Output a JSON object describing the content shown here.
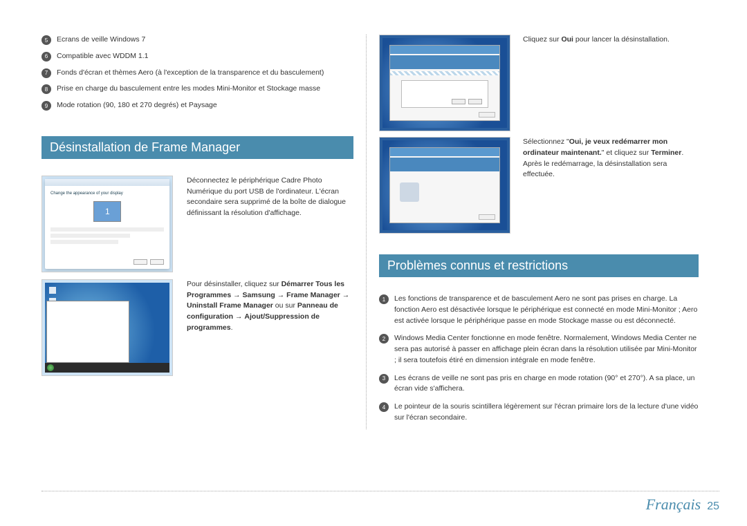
{
  "numbered_top": [
    {
      "n": "5",
      "text": "Ecrans de veille Windows 7"
    },
    {
      "n": "6",
      "text": "Compatible avec WDDM 1.1"
    },
    {
      "n": "7",
      "text": "Fonds d'écran et thèmes Aero (à l'exception de la transparence et du basculement)"
    },
    {
      "n": "8",
      "text": "Prise en charge du basculement entre les modes Mini-Monitor et Stockage masse"
    },
    {
      "n": "9",
      "text": "Mode rotation (90, 180 et 270 degrés) et Paysage"
    }
  ],
  "heading_uninstall": "Désinstallation de Frame Manager",
  "uninstall_steps": [
    {
      "text": "Déconnectez le périphérique Cadre Photo Numérique du port USB de l'ordinateur. L'écran secondaire sera supprimé de la boîte de dialogue définissant la résolution d'affichage."
    },
    {
      "html_parts": {
        "p": "Pour désinstaller, cliquez sur ",
        "b1": "Démarrer Tous les Programmes",
        "arrow1": " → ",
        "b2": "Samsung",
        "arrow2": " → ",
        "b3": "Frame Manager",
        "arrow3": " → ",
        "b4": "Uninstall Frame Manager",
        "mid": " ou sur ",
        "b5": "Panneau de configuration",
        "arrow4": " → ",
        "b6": "Ajout/Suppression de programmes",
        "end": "."
      }
    }
  ],
  "right_rows": [
    {
      "pre": "Cliquez sur ",
      "b": "Oui",
      "post": " pour lancer la désinstallation."
    },
    {
      "pre": "Sélectionnez \"",
      "b": "Oui, je veux redémarrer mon ordinateur maintenant.",
      "post2": "\" et cliquez sur ",
      "b2": "Terminer",
      "post3": ". Après le redémarrage, la désinstallation sera effectuée."
    }
  ],
  "heading_issues": "Problèmes connus et restrictions",
  "issues": [
    {
      "n": "1",
      "text": "Les fonctions de transparence et de basculement Aero ne sont pas prises en charge. La fonction Aero est désactivée lorsque le périphérique est connecté en mode Mini-Monitor ; Aero est activée lorsque le périphérique passe en mode Stockage masse ou est déconnecté."
    },
    {
      "n": "2",
      "text": "Windows Media Center fonctionne en mode fenêtre. Normalement, Windows Media Center ne sera pas autorisé à passer en affichage plein écran dans la résolution utilisée par Mini-Monitor ; il sera toutefois étiré en dimension intégrale en mode fenêtre."
    },
    {
      "n": "3",
      "text": "Les écrans de veille ne sont pas pris en charge en mode rotation (90° et 270°). A sa place, un écran vide s'affichera."
    },
    {
      "n": "4",
      "text": "Le pointeur de la souris scintillera légèrement sur l'écran primaire lors de la lecture d'une vidéo sur l'écran secondaire."
    }
  ],
  "footer": {
    "lang": "Français",
    "page": "25"
  }
}
